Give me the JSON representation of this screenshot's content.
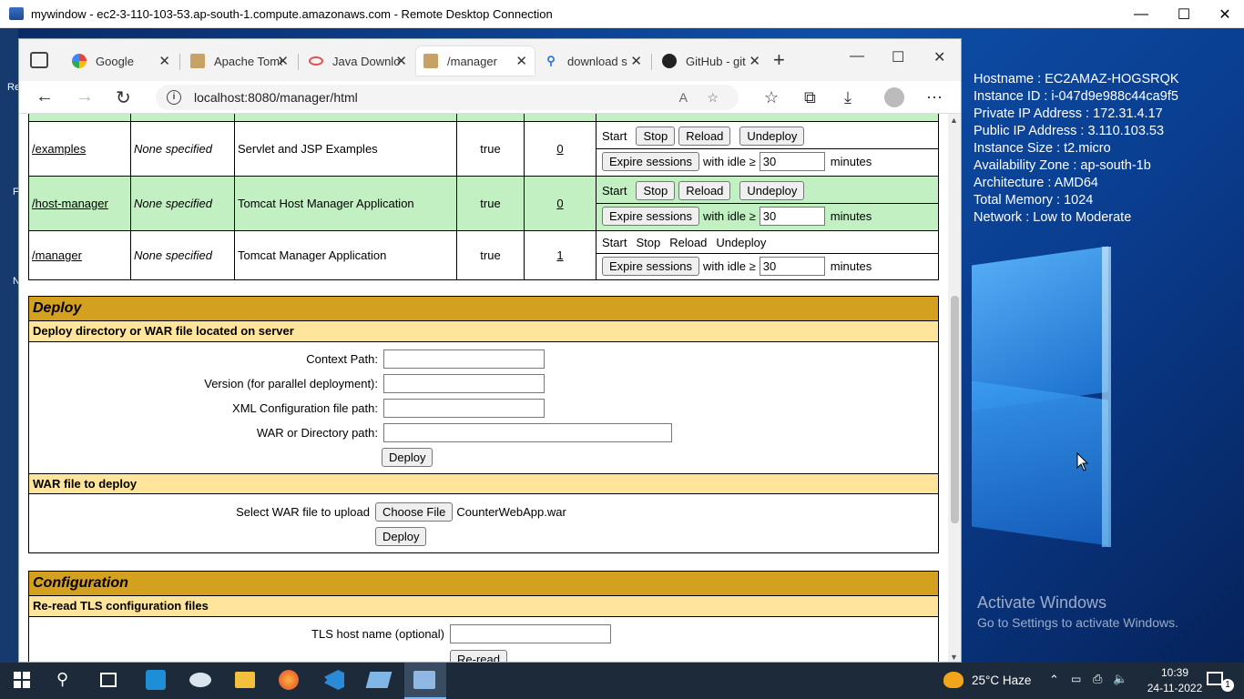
{
  "rdp": {
    "title": "mywindow - ec2-3-110-103-53.ap-south-1.compute.amazonaws.com - Remote Desktop Connection",
    "min": "—",
    "max": "☐",
    "close": "✕"
  },
  "left_strip": [
    "Re",
    "F",
    "N"
  ],
  "instance_info": [
    "Hostname : EC2AMAZ-HOGSRQK",
    "Instance ID : i-047d9e988c44ca9f5",
    "Private IP Address : 172.31.4.17",
    "Public IP Address : 3.110.103.53",
    "Instance Size : t2.micro",
    "Availability Zone : ap-south-1b",
    "Architecture : AMD64",
    "Total Memory : 1024",
    "Network : Low to Moderate"
  ],
  "activate": {
    "line1": "Activate Windows",
    "line2": "Go to Settings to activate Windows."
  },
  "browser": {
    "tabs": [
      {
        "title": "Google",
        "color": "#4285f4"
      },
      {
        "title": "Apache Tomcat",
        "color": "#8b5a2b"
      },
      {
        "title": "Java Download",
        "color": "#e05050"
      },
      {
        "title": "/manager",
        "color": "#8b5a2b"
      },
      {
        "title": "download s",
        "color": "#2a6fdb"
      },
      {
        "title": "GitHub - git",
        "color": "#222222"
      }
    ],
    "url": "localhost:8080/manager/html"
  },
  "apps_table": {
    "rows": [
      {
        "path": "/examples",
        "version": "None specified",
        "display": "Servlet and JSP Examples",
        "running": "true",
        "sessions": "0",
        "style": "white"
      },
      {
        "path": "/host-manager",
        "version": "None specified",
        "display": "Tomcat Host Manager Application",
        "running": "true",
        "sessions": "0",
        "style": "green"
      },
      {
        "path": "/manager",
        "version": "None specified",
        "display": "Tomcat Manager Application",
        "running": "true",
        "sessions": "1",
        "style": "white"
      }
    ],
    "start": "Start",
    "stop": "Stop",
    "reload": "Reload",
    "undeploy": "Undeploy",
    "expire": "Expire sessions",
    "with_idle": "with idle ≥",
    "idle_value": "30",
    "minutes": "minutes"
  },
  "deploy": {
    "title": "Deploy",
    "server_sub": "Deploy directory or WAR file located on server",
    "context_path": "Context Path:",
    "version": "Version (for parallel deployment):",
    "xml_path": "XML Configuration file path:",
    "war_path": "WAR or Directory path:",
    "deploy_btn": "Deploy",
    "war_sub": "WAR file to deploy",
    "select_war": "Select WAR file to upload",
    "choose_file": "Choose File",
    "chosen_file": "CounterWebApp.war"
  },
  "config": {
    "title": "Configuration",
    "sub": "Re-read TLS configuration files",
    "tls_label": "TLS host name (optional)",
    "reread": "Re-read"
  },
  "taskbar": {
    "weather": "25°C  Haze",
    "time": "10:39",
    "date": "24-11-2022",
    "notif_count": "1"
  }
}
